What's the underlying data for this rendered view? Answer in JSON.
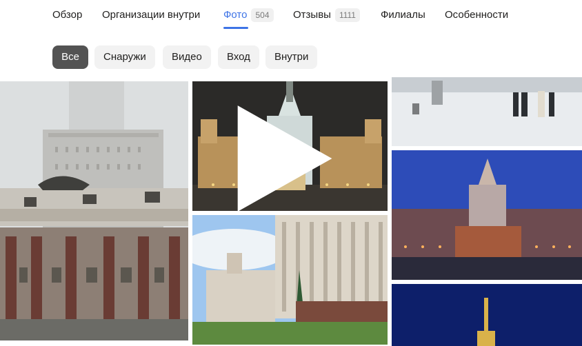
{
  "tabs": [
    {
      "label": "Обзор"
    },
    {
      "label": "Организации внутри"
    },
    {
      "label": "Фото",
      "count": "504",
      "active": true
    },
    {
      "label": "Отзывы",
      "count": "1111"
    },
    {
      "label": "Филиалы"
    },
    {
      "label": "Особенности"
    }
  ],
  "filters": [
    {
      "label": "Все",
      "active": true
    },
    {
      "label": "Снаружи"
    },
    {
      "label": "Видео"
    },
    {
      "label": "Вход"
    },
    {
      "label": "Внутри"
    }
  ],
  "colors": {
    "accent": "#3d73e6",
    "chip_active": "#535353",
    "chip_bg": "#f2f2f2"
  },
  "icons": {
    "video": "play-icon"
  }
}
